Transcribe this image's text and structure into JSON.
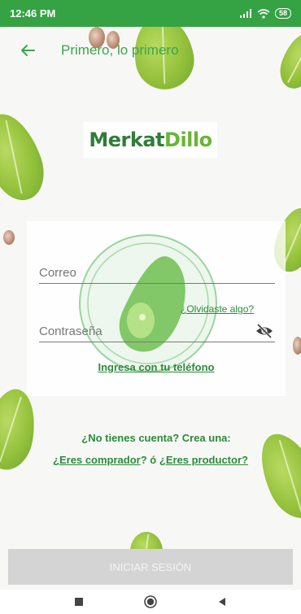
{
  "status_bar": {
    "time": "12:46 PM",
    "battery": "58"
  },
  "app_bar": {
    "title": "Primero, lo primero"
  },
  "logo": {
    "part1": "Merkat",
    "part2": "Dillo"
  },
  "form": {
    "email_placeholder": "Correo",
    "password_placeholder": "Contraseña",
    "forgot_label": "¿Olvidaste algo?",
    "phone_label": "Ingresa con tu teléfono"
  },
  "signup": {
    "prompt": "¿No tienes cuenta? Crea una:",
    "buyer_prefix": "¿Eres",
    "buyer_label": "comprador",
    "buyer_suffix": "?",
    "separator": "ó",
    "producer_label": "¿Eres productor?"
  },
  "login_button": {
    "label": "INICIAR SESIÓN"
  },
  "colors": {
    "status_bar": "#35a243",
    "brand_green": "#3aa64a",
    "link_green": "#2d8a3c",
    "button_disabled": "#d4d4d4"
  },
  "icons": {
    "back": "arrow-left-icon",
    "visibility": "eye-off-icon",
    "nav_recents": "square-icon",
    "nav_home": "circle-icon",
    "nav_back": "triangle-left-icon"
  }
}
